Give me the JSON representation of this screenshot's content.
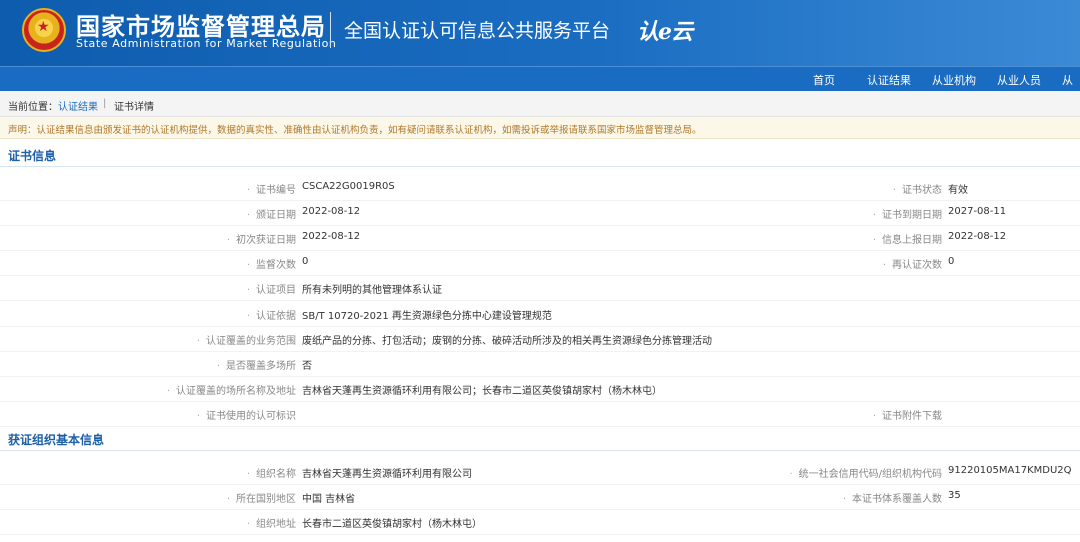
{
  "header": {
    "agency_cn": "国家市场监督管理总局",
    "agency_en": "State Administration  for  Market Regulation",
    "platform_title": "全国认证认可信息公共服务平台",
    "logo_text": "认e云",
    "colors": {
      "primary": "#1a6cc2",
      "header_gradient_end": "#3b8ad6",
      "title_blue": "#1d5fa8",
      "notice_text": "#b0782a"
    }
  },
  "nav": {
    "items": [
      {
        "label": "首页"
      },
      {
        "label": "认证结果"
      },
      {
        "label": "从业机构"
      },
      {
        "label": "从业人员"
      },
      {
        "label": "从"
      }
    ]
  },
  "breadcrumb": {
    "prefix": "当前位置：",
    "items": [
      {
        "label": "认证结果"
      },
      {
        "label": "证书详情"
      }
    ],
    "separator": "|"
  },
  "notice": "声明：认证结果信息由颁发证书的认证机构提供，数据的真实性、准确性由认证机构负责，如有疑问请联系认证机构，如需投诉或举报请联系国家市场监督管理总局。",
  "certificate_section": {
    "title": "证书信息",
    "rows": [
      {
        "label": "证书编号",
        "value": "CSCA22G0019R0S",
        "right_label": "证书状态",
        "right_value": "有效"
      },
      {
        "label": "颁证日期",
        "value": "2022-08-12",
        "right_label": "证书到期日期",
        "right_value": "2027-08-11"
      },
      {
        "label": "初次获证日期",
        "value": "2022-08-12",
        "right_label": "信息上报日期",
        "right_value": "2022-08-12"
      },
      {
        "label": "监督次数",
        "value": "0",
        "right_label": "再认证次数",
        "right_value": "0"
      },
      {
        "label": "认证项目",
        "value": "所有未列明的其他管理体系认证"
      },
      {
        "label": "认证依据",
        "value": "SB/T 10720-2021 再生资源绿色分拣中心建设管理规范"
      },
      {
        "label": "认证覆盖的业务范围",
        "value": "废纸产品的分拣、打包活动；废钢的分拣、破碎活动所涉及的相关再生资源绿色分拣管理活动"
      },
      {
        "label": "是否覆盖多场所",
        "value": "否"
      },
      {
        "label": "认证覆盖的场所名称及地址",
        "value": "吉林省天蓬再生资源循环利用有限公司；长春市二道区英俊镇胡家村（杨木林屯）"
      },
      {
        "label": "证书使用的认可标识",
        "value": "",
        "right_label": "证书附件下载",
        "right_value": ""
      }
    ]
  },
  "org_section": {
    "title": "获证组织基本信息",
    "rows": [
      {
        "label": "组织名称",
        "value": "吉林省天蓬再生资源循环利用有限公司",
        "right_label": "统一社会信用代码/组织机构代码",
        "right_value": "91220105MA17KMDU2Q"
      },
      {
        "label": "所在国别地区",
        "value": "中国 吉林省",
        "right_label": "本证书体系覆盖人数",
        "right_value": "35"
      },
      {
        "label": "组织地址",
        "value": "长春市二道区英俊镇胡家村（杨木林屯）"
      }
    ]
  }
}
